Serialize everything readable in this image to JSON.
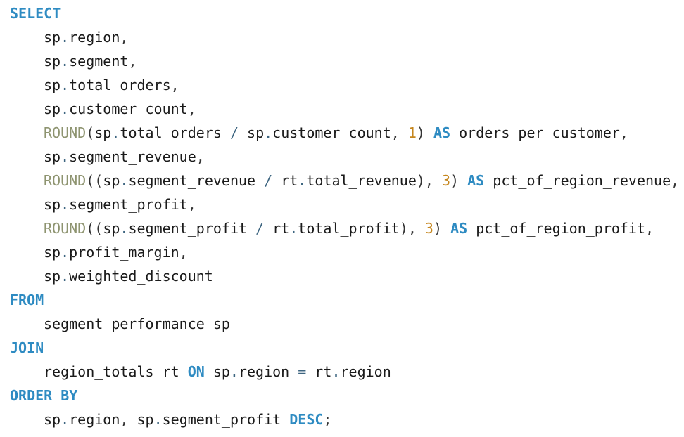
{
  "editor": {
    "colors": {
      "keyword": "#2e8bc2",
      "function": "#8e9470",
      "number": "#c5861d",
      "operator": "#3d6580",
      "text": "#1a1a1a",
      "background": "#ffffff"
    },
    "lines": [
      {
        "indent": false,
        "tokens": [
          {
            "t": "SELECT",
            "k": "keyword"
          }
        ]
      },
      {
        "indent": true,
        "tokens": [
          {
            "t": "sp",
            "k": "ident"
          },
          {
            "t": ".",
            "k": "op"
          },
          {
            "t": "region",
            "k": "ident"
          },
          {
            "t": ",",
            "k": "punct"
          }
        ]
      },
      {
        "indent": true,
        "tokens": [
          {
            "t": "sp",
            "k": "ident"
          },
          {
            "t": ".",
            "k": "op"
          },
          {
            "t": "segment",
            "k": "ident"
          },
          {
            "t": ",",
            "k": "punct"
          }
        ]
      },
      {
        "indent": true,
        "tokens": [
          {
            "t": "sp",
            "k": "ident"
          },
          {
            "t": ".",
            "k": "op"
          },
          {
            "t": "total_orders",
            "k": "ident"
          },
          {
            "t": ",",
            "k": "punct"
          }
        ]
      },
      {
        "indent": true,
        "tokens": [
          {
            "t": "sp",
            "k": "ident"
          },
          {
            "t": ".",
            "k": "op"
          },
          {
            "t": "customer_count",
            "k": "ident"
          },
          {
            "t": ",",
            "k": "punct"
          }
        ]
      },
      {
        "indent": true,
        "tokens": [
          {
            "t": "ROUND",
            "k": "function"
          },
          {
            "t": "(",
            "k": "paren"
          },
          {
            "t": "sp",
            "k": "ident"
          },
          {
            "t": ".",
            "k": "op"
          },
          {
            "t": "total_orders ",
            "k": "ident"
          },
          {
            "t": "/",
            "k": "op"
          },
          {
            "t": " sp",
            "k": "ident"
          },
          {
            "t": ".",
            "k": "op"
          },
          {
            "t": "customer_count",
            "k": "ident"
          },
          {
            "t": ", ",
            "k": "punct"
          },
          {
            "t": "1",
            "k": "number"
          },
          {
            "t": ") ",
            "k": "paren"
          },
          {
            "t": "AS",
            "k": "keyword"
          },
          {
            "t": " orders_per_customer",
            "k": "ident"
          },
          {
            "t": ",",
            "k": "punct"
          }
        ]
      },
      {
        "indent": true,
        "tokens": [
          {
            "t": "sp",
            "k": "ident"
          },
          {
            "t": ".",
            "k": "op"
          },
          {
            "t": "segment_revenue",
            "k": "ident"
          },
          {
            "t": ",",
            "k": "punct"
          }
        ]
      },
      {
        "indent": true,
        "tokens": [
          {
            "t": "ROUND",
            "k": "function"
          },
          {
            "t": "((",
            "k": "paren"
          },
          {
            "t": "sp",
            "k": "ident"
          },
          {
            "t": ".",
            "k": "op"
          },
          {
            "t": "segment_revenue ",
            "k": "ident"
          },
          {
            "t": "/",
            "k": "op"
          },
          {
            "t": " rt",
            "k": "ident"
          },
          {
            "t": ".",
            "k": "op"
          },
          {
            "t": "total_revenue",
            "k": "ident"
          },
          {
            "t": "), ",
            "k": "paren"
          },
          {
            "t": "3",
            "k": "number"
          },
          {
            "t": ") ",
            "k": "paren"
          },
          {
            "t": "AS",
            "k": "keyword"
          },
          {
            "t": " pct_of_region_revenue",
            "k": "ident"
          },
          {
            "t": ",",
            "k": "punct"
          }
        ]
      },
      {
        "indent": true,
        "tokens": [
          {
            "t": "sp",
            "k": "ident"
          },
          {
            "t": ".",
            "k": "op"
          },
          {
            "t": "segment_profit",
            "k": "ident"
          },
          {
            "t": ",",
            "k": "punct"
          }
        ]
      },
      {
        "indent": true,
        "tokens": [
          {
            "t": "ROUND",
            "k": "function"
          },
          {
            "t": "((",
            "k": "paren"
          },
          {
            "t": "sp",
            "k": "ident"
          },
          {
            "t": ".",
            "k": "op"
          },
          {
            "t": "segment_profit ",
            "k": "ident"
          },
          {
            "t": "/",
            "k": "op"
          },
          {
            "t": " rt",
            "k": "ident"
          },
          {
            "t": ".",
            "k": "op"
          },
          {
            "t": "total_profit",
            "k": "ident"
          },
          {
            "t": "), ",
            "k": "paren"
          },
          {
            "t": "3",
            "k": "number"
          },
          {
            "t": ") ",
            "k": "paren"
          },
          {
            "t": "AS",
            "k": "keyword"
          },
          {
            "t": " pct_of_region_profit",
            "k": "ident"
          },
          {
            "t": ",",
            "k": "punct"
          }
        ]
      },
      {
        "indent": true,
        "tokens": [
          {
            "t": "sp",
            "k": "ident"
          },
          {
            "t": ".",
            "k": "op"
          },
          {
            "t": "profit_margin",
            "k": "ident"
          },
          {
            "t": ",",
            "k": "punct"
          }
        ]
      },
      {
        "indent": true,
        "tokens": [
          {
            "t": "sp",
            "k": "ident"
          },
          {
            "t": ".",
            "k": "op"
          },
          {
            "t": "weighted_discount",
            "k": "ident"
          }
        ]
      },
      {
        "indent": false,
        "tokens": [
          {
            "t": "FROM",
            "k": "keyword"
          }
        ]
      },
      {
        "indent": true,
        "tokens": [
          {
            "t": "segment_performance sp",
            "k": "ident"
          }
        ]
      },
      {
        "indent": false,
        "tokens": [
          {
            "t": "JOIN",
            "k": "keyword"
          }
        ]
      },
      {
        "indent": true,
        "tokens": [
          {
            "t": "region_totals rt ",
            "k": "ident"
          },
          {
            "t": "ON",
            "k": "keyword"
          },
          {
            "t": " sp",
            "k": "ident"
          },
          {
            "t": ".",
            "k": "op"
          },
          {
            "t": "region ",
            "k": "ident"
          },
          {
            "t": "=",
            "k": "op"
          },
          {
            "t": " rt",
            "k": "ident"
          },
          {
            "t": ".",
            "k": "op"
          },
          {
            "t": "region",
            "k": "ident"
          }
        ]
      },
      {
        "indent": false,
        "tokens": [
          {
            "t": "ORDER BY",
            "k": "keyword"
          }
        ]
      },
      {
        "indent": true,
        "tokens": [
          {
            "t": "sp",
            "k": "ident"
          },
          {
            "t": ".",
            "k": "op"
          },
          {
            "t": "region",
            "k": "ident"
          },
          {
            "t": ", ",
            "k": "punct"
          },
          {
            "t": "sp",
            "k": "ident"
          },
          {
            "t": ".",
            "k": "op"
          },
          {
            "t": "segment_profit ",
            "k": "ident"
          },
          {
            "t": "DESC",
            "k": "keyword"
          },
          {
            "t": ";",
            "k": "punct"
          }
        ]
      }
    ]
  }
}
